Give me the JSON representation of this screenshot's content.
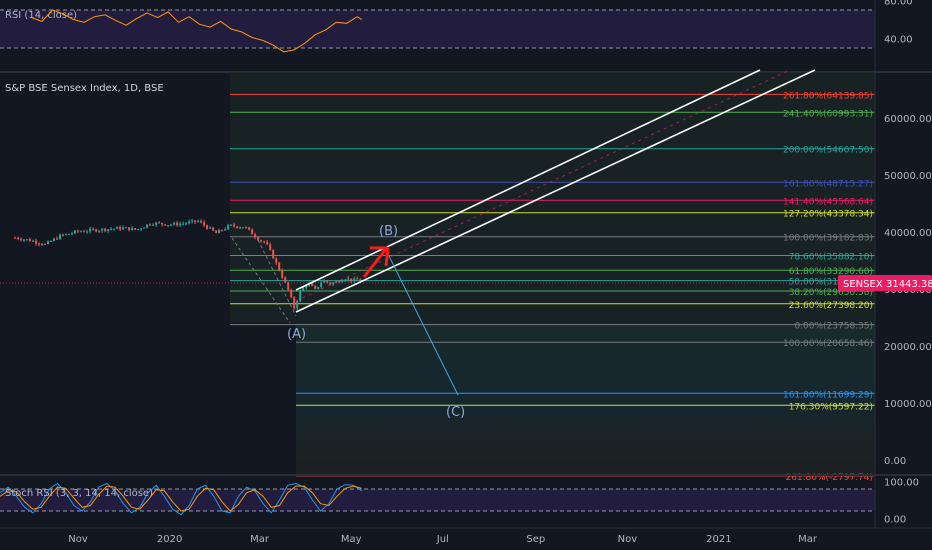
{
  "header": {
    "main_title": "S&P BSE Sensex Index, 1D, BSE",
    "rsi_title": "RSI (14, close)",
    "stoch_title": "Stoch RSI (3, 3, 14, 14, close)"
  },
  "price_tag": {
    "symbol": "SENSEX",
    "value": "31443.38",
    "color": "#e91e63"
  },
  "colors": {
    "background": "#131722",
    "channel": "#ffffff",
    "arrow": "#ff1a1a",
    "wave_label": "#8fa8d6",
    "rsi_line": "#ff9800",
    "stoch_k": "#2196f3",
    "stoch_d": "#ff9800"
  },
  "chart_data": [
    {
      "type": "line",
      "title": "RSI (14, close)",
      "yticks": [
        "80.00",
        "40.00"
      ],
      "levels": [
        70,
        30
      ],
      "ylim": [
        20,
        85
      ],
      "x": [
        "2019-10-01",
        "2019-10-08",
        "2019-10-15",
        "2019-10-22",
        "2019-10-29",
        "2019-11-05",
        "2019-11-12",
        "2019-11-19",
        "2019-11-26",
        "2019-12-03",
        "2019-12-10",
        "2019-12-17",
        "2019-12-24",
        "2019-12-31",
        "2020-01-07",
        "2020-01-14",
        "2020-01-21",
        "2020-01-28",
        "2020-02-04",
        "2020-02-11",
        "2020-02-18",
        "2020-02-25",
        "2020-03-03",
        "2020-03-10",
        "2020-03-17",
        "2020-03-24",
        "2020-03-31",
        "2020-04-07",
        "2020-04-14",
        "2020-04-21",
        "2020-04-28",
        "2020-05-05",
        "2020-05-08"
      ],
      "values": [
        62,
        58,
        70,
        66,
        60,
        57,
        63,
        65,
        59,
        54,
        61,
        67,
        62,
        68,
        57,
        63,
        55,
        52,
        58,
        50,
        47,
        41,
        38,
        33,
        26,
        28,
        35,
        44,
        49,
        57,
        56,
        63,
        60
      ]
    },
    {
      "type": "line",
      "title": "S&P BSE Sensex Index, 1D, BSE",
      "yticks": [
        "60000.00",
        "50000.00",
        "40000.00",
        "30000.00",
        "20000.00",
        "10000.00",
        "0.00"
      ],
      "ylim": [
        -3000,
        70000
      ],
      "xticks": [
        "Nov",
        "2020",
        "Mar",
        "May",
        "Jul",
        "Sep",
        "Nov",
        "2021",
        "Mar"
      ],
      "series": [
        {
          "x": [
            "2019-09-20",
            "2019-10-01",
            "2019-10-10",
            "2019-10-20",
            "2019-11-01",
            "2019-11-10",
            "2019-11-20",
            "2019-12-01",
            "2019-12-10",
            "2019-12-20",
            "2020-01-01",
            "2020-01-10",
            "2020-01-20",
            "2020-02-01",
            "2020-02-10",
            "2020-02-20",
            "2020-03-01",
            "2020-03-05",
            "2020-03-10",
            "2020-03-15",
            "2020-03-20",
            "2020-03-24",
            "2020-03-28",
            "2020-04-02",
            "2020-04-07",
            "2020-04-12",
            "2020-04-17",
            "2020-04-22",
            "2020-04-27",
            "2020-05-02",
            "2020-05-07",
            "2020-05-08"
          ],
          "values": [
            39000,
            38500,
            37800,
            39300,
            40100,
            40300,
            40500,
            40700,
            40400,
            41600,
            41300,
            41500,
            41900,
            39800,
            41100,
            40900,
            38600,
            38100,
            35600,
            32800,
            29800,
            26700,
            29500,
            31100,
            29800,
            31600,
            30900,
            31400,
            31900,
            31500,
            31700,
            31443
          ]
        }
      ],
      "fib_levels": [
        {
          "label": "261.80%(64139.85)",
          "value": 64139.85,
          "color": "#f44336"
        },
        {
          "label": "241.40%(60993.31)",
          "value": 60993.31,
          "color": "#4caf50"
        },
        {
          "label": "200.00%(54607.50)",
          "value": 54607.5,
          "color": "#26a69a"
        },
        {
          "label": "161.80%(48715.27)",
          "value": 48715.27,
          "color": "#3f51b5"
        },
        {
          "label": "141.40%(45568.64)",
          "value": 45568.64,
          "color": "#e91e63"
        },
        {
          "label": "127.20%(43378.34)",
          "value": 43378.34,
          "color": "#cddc39"
        },
        {
          "label": "100.00%(39182.83)",
          "value": 39182.83,
          "color": "#787b86"
        },
        {
          "label": "78.60%(35882.10)",
          "value": 35882.1,
          "color": "#26a69a"
        },
        {
          "label": "61.80%(33290.60)",
          "value": 33290.6,
          "color": "#4caf50"
        },
        {
          "label": "50.00%(31470.59)",
          "value": 31470.59,
          "color": "#26a69a"
        },
        {
          "label": "38.20%(29650.58)",
          "value": 29650.58,
          "color": "#4caf50"
        },
        {
          "label": "23.60%(27398.20)",
          "value": 27398.2,
          "color": "#cddc39"
        },
        {
          "label": "0.00%(23758.35)",
          "value": 23758.35,
          "color": "#787b86"
        },
        {
          "label": "100.00%(20658.46)",
          "value": 20658.46,
          "color": "#787b86"
        },
        {
          "label": "161.80%(11699.29)",
          "value": 11699.29,
          "color": "#2196f3"
        },
        {
          "label": "176.30%(9597.22)",
          "value": 9597.22,
          "color": "#cddc39"
        },
        {
          "label": "261.80%(-2797.74)",
          "value": -2797.74,
          "color": "#f44336"
        }
      ],
      "annotations": [
        "(A)",
        "(B)",
        "(C)"
      ]
    },
    {
      "type": "line",
      "title": "Stoch RSI (3, 3, 14, 14, close)",
      "yticks": [
        "100.00",
        "0.00"
      ],
      "levels": [
        80,
        20
      ],
      "ylim": [
        -5,
        105
      ],
      "series": [
        {
          "values": [
            70,
            85,
            60,
            30,
            15,
            40,
            80,
            95,
            70,
            35,
            20,
            45,
            85,
            95,
            75,
            40,
            15,
            30,
            70,
            90,
            60,
            25,
            10,
            35,
            80,
            90,
            60,
            20,
            15,
            60,
            85,
            75,
            40,
            15,
            50,
            90,
            95,
            85,
            50,
            20,
            40,
            80,
            92,
            90,
            75
          ]
        },
        {
          "values": [
            60,
            75,
            72,
            45,
            25,
            30,
            60,
            85,
            82,
            55,
            30,
            35,
            65,
            88,
            85,
            60,
            30,
            25,
            50,
            78,
            75,
            45,
            20,
            25,
            60,
            82,
            78,
            45,
            20,
            38,
            70,
            78,
            60,
            30,
            35,
            70,
            88,
            88,
            70,
            40,
            35,
            60,
            82,
            88,
            82
          ]
        }
      ]
    }
  ]
}
